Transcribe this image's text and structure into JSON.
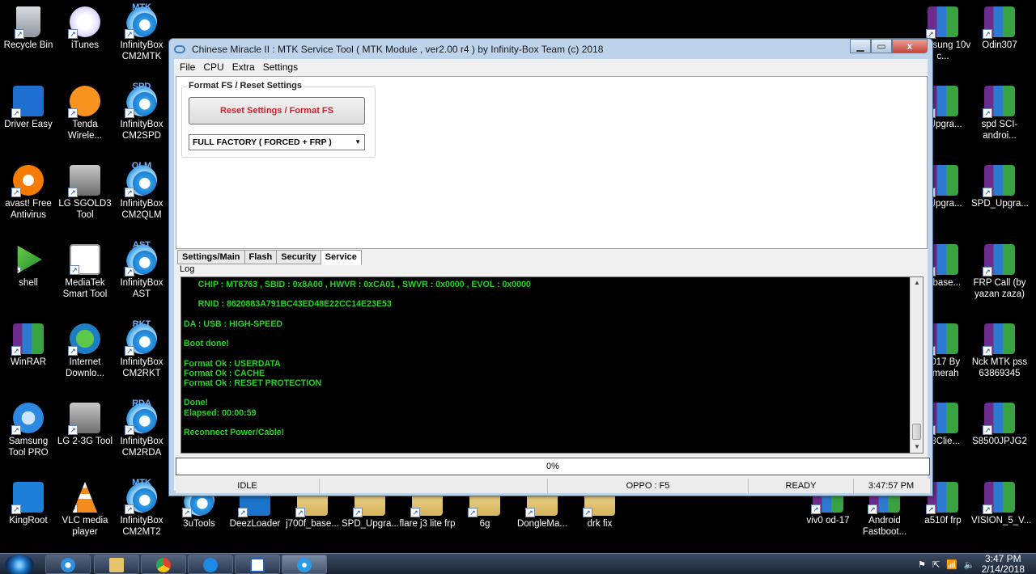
{
  "desktop": {
    "left_icons": [
      {
        "label": "Recycle Bin",
        "kind": "bin",
        "tag": ""
      },
      {
        "label": "iTunes",
        "kind": "itunes",
        "tag": ""
      },
      {
        "label": "InfinityBox CM2MTK",
        "kind": "infbox",
        "tag": "MTK"
      },
      {
        "label": "Driver Easy",
        "kind": "drivereasy",
        "tag": ""
      },
      {
        "label": "Tenda Wirele...",
        "kind": "tenda",
        "tag": ""
      },
      {
        "label": "InfinityBox CM2SPD",
        "kind": "infbox",
        "tag": "SPD"
      },
      {
        "label": "avast! Free Antivirus",
        "kind": "avast",
        "tag": ""
      },
      {
        "label": "LG SGOLD3 Tool",
        "kind": "lg",
        "tag": ""
      },
      {
        "label": "InfinityBox CM2QLM",
        "kind": "infbox",
        "tag": "QLM"
      },
      {
        "label": "shell",
        "kind": "shell",
        "tag": ""
      },
      {
        "label": "MediaTek Smart Tool",
        "kind": "mediatek",
        "tag": ""
      },
      {
        "label": "InfinityBox AST",
        "kind": "infbox",
        "tag": "AST"
      },
      {
        "label": "WinRAR",
        "kind": "winrar",
        "tag": ""
      },
      {
        "label": "Internet Downlo...",
        "kind": "idm",
        "tag": ""
      },
      {
        "label": "InfinityBox CM2RKT",
        "kind": "infbox",
        "tag": "RKT"
      },
      {
        "label": "Samsung Tool PRO",
        "kind": "samsungtool",
        "tag": ""
      },
      {
        "label": "LG 2-3G Tool",
        "kind": "lg",
        "tag": ""
      },
      {
        "label": "InfinityBox CM2RDA",
        "kind": "infbox",
        "tag": "RDA"
      },
      {
        "label": "KingRoot",
        "kind": "kingroot",
        "tag": ""
      },
      {
        "label": "VLC media player",
        "kind": "vlc",
        "tag": ""
      },
      {
        "label": "InfinityBox CM2MT2",
        "kind": "infbox",
        "tag": "MTK"
      }
    ],
    "bottom_icons": [
      "3uTools",
      "DeezLoader",
      "j700f_base...",
      "SPD_Upgra...",
      "flare j3 lite frp",
      "6g",
      "DongleMa...",
      "drk fix"
    ],
    "right_icons": [
      {
        "label": "samsung 10v c..."
      },
      {
        "label": "Odin307"
      },
      {
        "label": "_Upgra..."
      },
      {
        "label": "spd SCI-androi..."
      },
      {
        "label": "_Upgra..."
      },
      {
        "label": "SPD_Upgra..."
      },
      {
        "label": "f_base..."
      },
      {
        "label": "FRP Call (by yazan zaza)"
      },
      {
        "label": "2017 By hmerah"
      },
      {
        "label": "Nck MTK pss 63869345"
      },
      {
        "label": "p8Clie..."
      },
      {
        "label": "S8500JPJG2"
      },
      {
        "label": "viv0 od-17"
      },
      {
        "label": "Android Fastboot..."
      },
      {
        "label": "a510f frp"
      },
      {
        "label": "VISION_5_V..."
      }
    ]
  },
  "window": {
    "title": "Chinese Miracle II : MTK Service Tool ( MTK Module , ver2.00 r4 ) by Infinity-Box Team (c) 2018",
    "min_label": "▁",
    "max_label": "▭",
    "close_label": "x",
    "menu": [
      "File",
      "CPU",
      "Extra",
      "Settings"
    ],
    "group_title": "Format FS / Reset Settings",
    "reset_button": "Reset Settings / Format FS",
    "mode_select": "FULL FACTORY ( FORCED + FRP )",
    "tabs": [
      "Settings/Main",
      "Flash",
      "Security",
      "Service"
    ],
    "active_tab": "Service",
    "log_label": "Log",
    "log_text": "      CHIP : MT6763 , SBID : 0x8A00 , HWVR : 0xCA01 , SWVR : 0x0000 , EVOL : 0x0000\n\n      RNID : 8620883A791BC43ED48E22CC14E23E53\n\nDA : USB : HIGH-SPEED\n\nBoot done!\n\nFormat Ok : USERDATA\nFormat Ok : CACHE\nFormat Ok : RESET PROTECTION\n\nDone!\nElapsed: 00:00:59\n\nReconnect Power/Cable!",
    "progress": "0%",
    "status": {
      "state": "IDLE",
      "device": "OPPO : F5",
      "ready": "READY",
      "time": "3:47:57 PM"
    }
  },
  "taskbar": {
    "clock_time": "3:47 PM",
    "clock_date": "2/14/2018"
  }
}
